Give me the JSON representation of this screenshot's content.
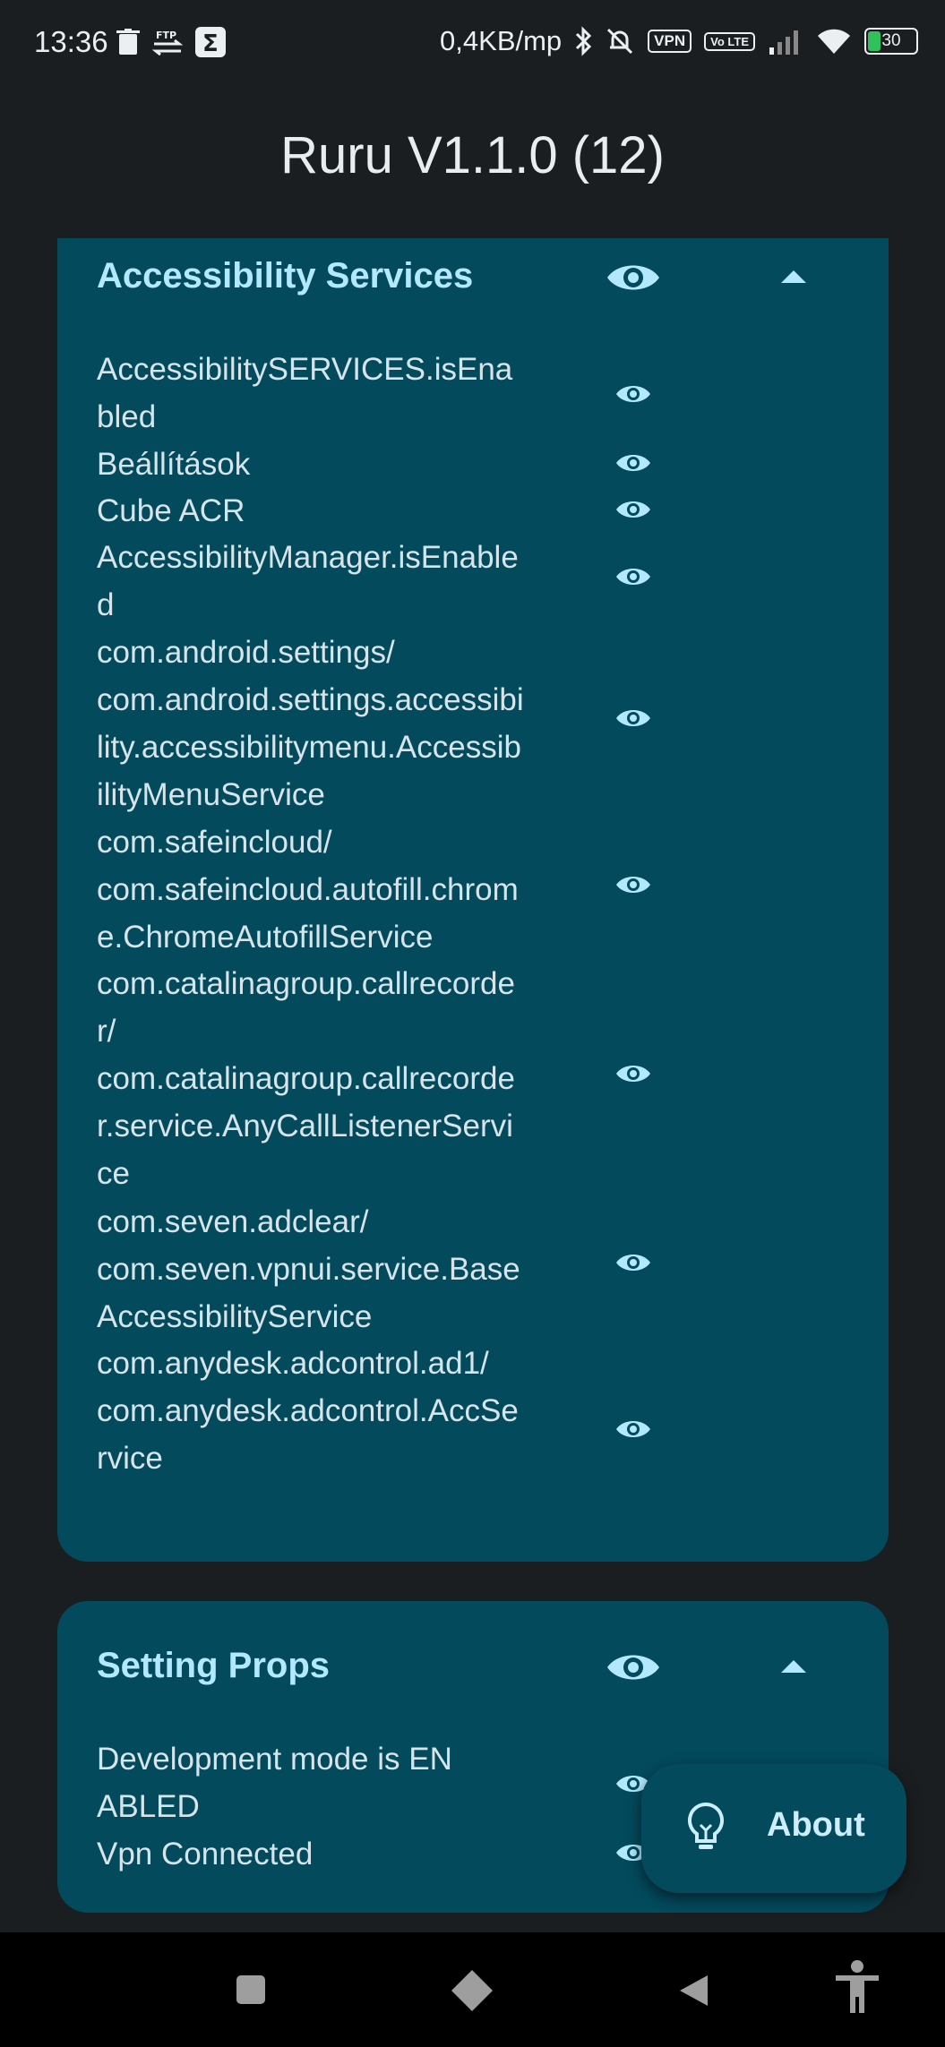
{
  "status_bar": {
    "time": "13:36",
    "net_speed": "0,4KB/mp",
    "vpn_badge": "VPN",
    "volte_badge": "Vo LTE",
    "battery": "30",
    "left_icons": [
      "trash-icon",
      "ftp-icon",
      "sigma-icon"
    ],
    "right_icons": [
      "bluetooth-icon",
      "muted-bell-icon",
      "signal-icon",
      "wifi-icon"
    ]
  },
  "app": {
    "title": "Ruru V1.1.0 (12)"
  },
  "sections": [
    {
      "title": "Accessibility Services",
      "expanded": true,
      "items": [
        "AccessibilitySERVICES.isEnabled",
        "Beállítások",
        "Cube ACR",
        "AccessibilityManager.isEnabled",
        "com.android.settings/\ncom.android.settings.accessibility.accessibilitymenu.AccessibilityMenuService",
        "com.safeincloud/\ncom.safeincloud.autofill.chrome.ChromeAutofillService",
        "com.catalinagroup.callrecorder/\ncom.catalinagroup.callrecorder.service.AnyCallListenerService",
        "com.seven.adclear/\ncom.seven.vpnui.service.BaseAccessibilityService",
        "com.anydesk.adcontrol.ad1/\ncom.anydesk.adcontrol.AccService"
      ]
    },
    {
      "title": "Setting Props",
      "expanded": true,
      "items": [
        "Development mode is ENABLED",
        "Vpn Connected"
      ]
    }
  ],
  "fab": {
    "label": "About",
    "icon": "lightbulb-icon"
  },
  "nav_bar": {
    "icons": [
      "recents-square-icon",
      "home-diamond-icon",
      "back-triangle-icon",
      "accessibility-icon"
    ]
  },
  "colors": {
    "background": "#1b1e20",
    "card": "#034a5d",
    "accent": "#b3e9ff",
    "text": "#d7e4e9"
  }
}
